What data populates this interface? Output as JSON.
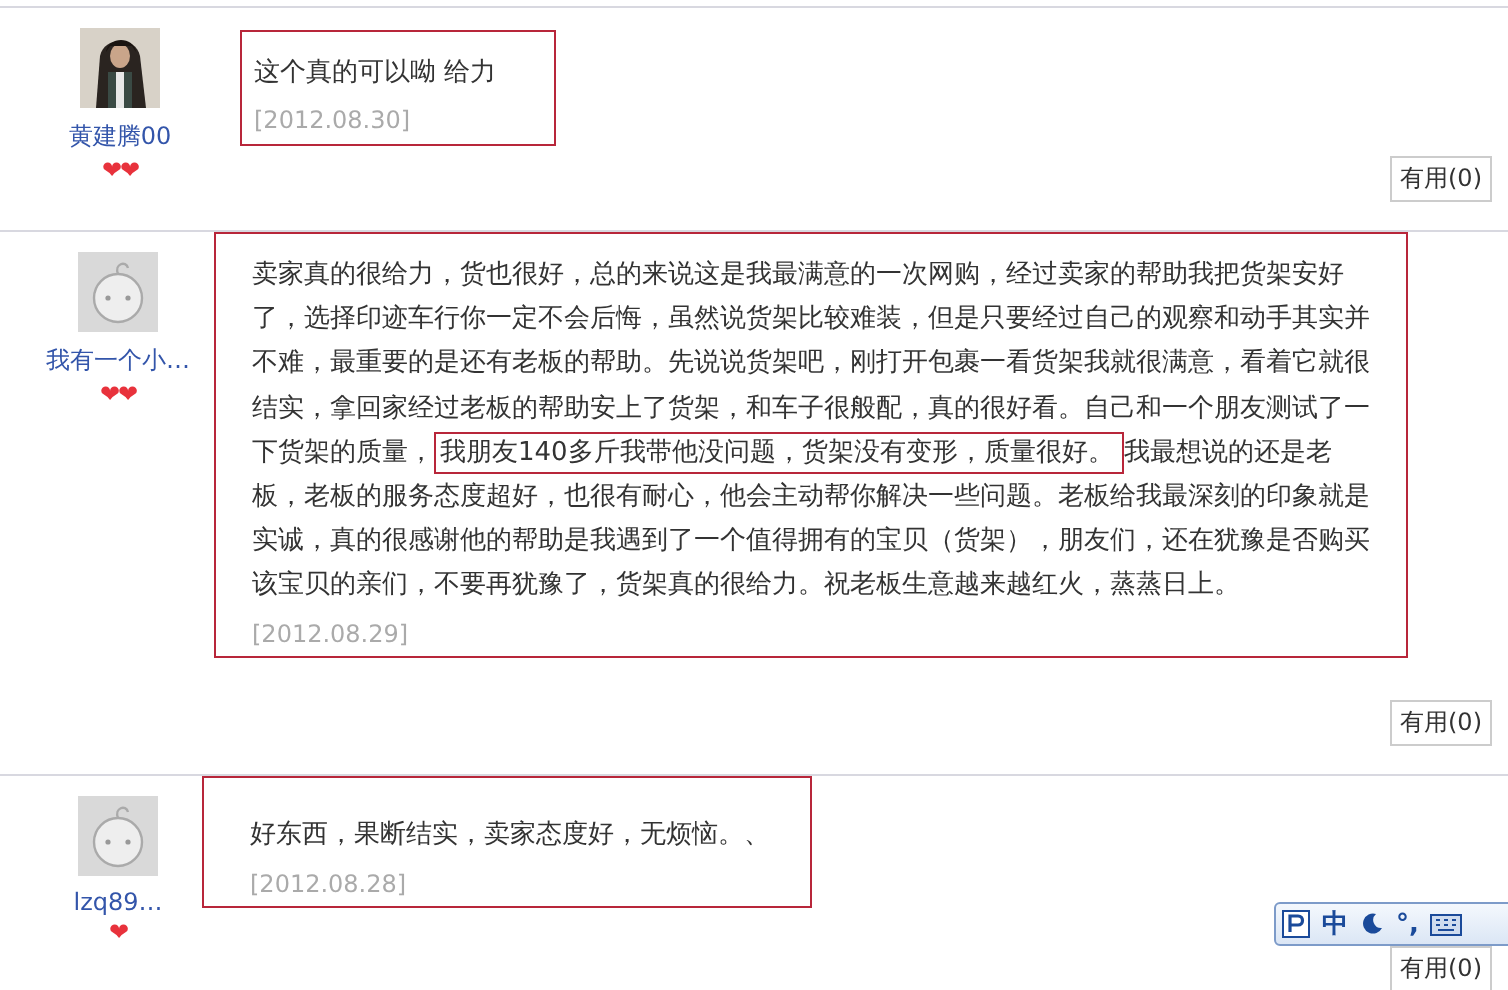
{
  "reviews": [
    {
      "user": {
        "name": "黄建腾00",
        "badge": "❤❤"
      },
      "text": "这个真的可以呦 给力",
      "date": "[2012.08.30]",
      "useful_button": "有用(0)"
    },
    {
      "user": {
        "name": "我有一个小…",
        "avatar": {
          "kind": "icon"
        },
        "badge": "❤❤"
      },
      "text_before": "卖家真的很给力，货也很好，总的来说这是我最满意的一次网购，经过卖家的帮助我把货架安好了，选择印迹车行你一定不会后悔，虽然说货架比较难装，但是只要经过自己的观察和动手其实并不难，最重要的是还有老板的帮助。先说说货架吧，刚打开包裹一看货架我就很满意，看着它就很结实，拿回家经过老板的帮助安上了货架，和车子很般配，真的很好看。自己和一个朋友测试了一下货架的质量，",
      "text_highlight": "我朋友140多斤我带他没问题，货架没有变形，质量很好。",
      "text_after": "我最想说的还是老板，老板的服务态度超好，也很有耐心，他会主动帮你解决一些问题。老板给我最深刻的印象就是实诚，真的很感谢他的帮助是我遇到了一个值得拥有的宝贝（货架），朋友们，还在犹豫是否购买该宝贝的亲们，不要再犹豫了，货架真的很给力。祝老板生意越来越红火，蒸蒸日上。",
      "date": "[2012.08.29]",
      "useful_button": "有用(0)"
    },
    {
      "user": {
        "name": "lzq89…",
        "avatar": {
          "kind": "icon"
        },
        "badge": "❤"
      },
      "text": "好东西，果断结实，卖家态度好，无烦恼。、",
      "date": "[2012.08.28]",
      "useful_button": "有用(0)"
    }
  ],
  "ime_toolbar": {
    "mode": "中",
    "punct": "°,"
  }
}
